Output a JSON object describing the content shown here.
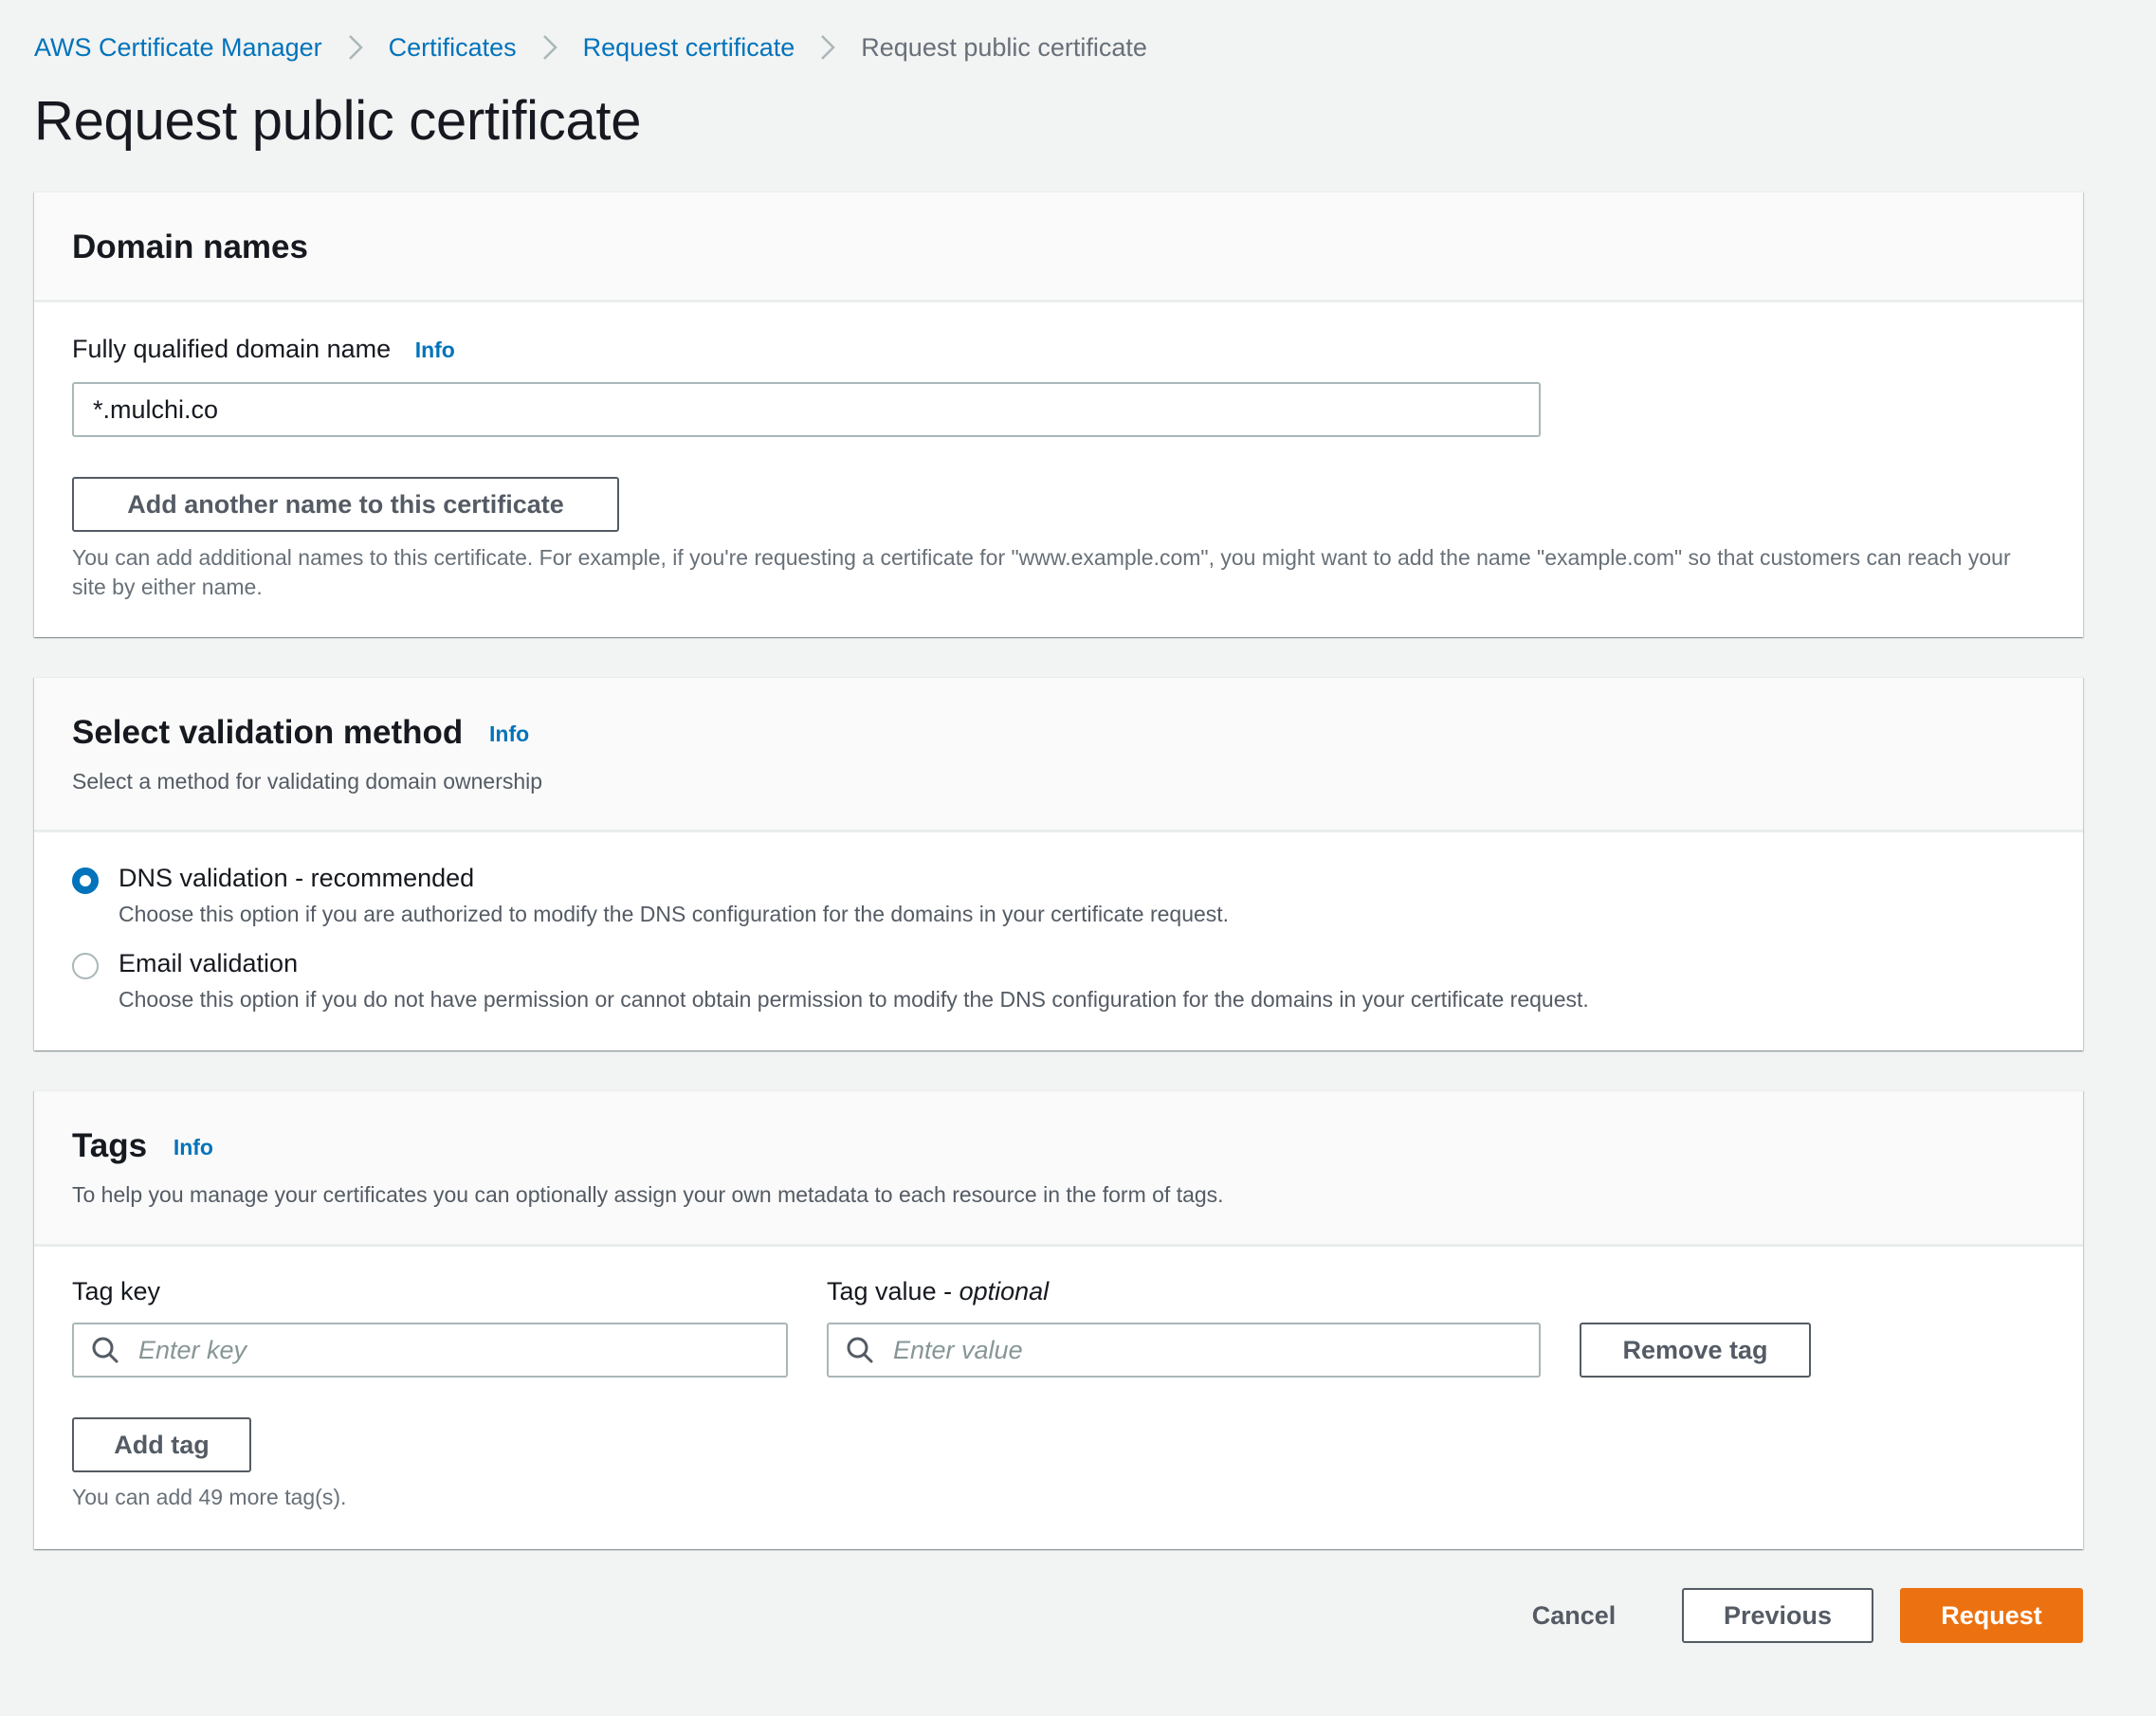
{
  "breadcrumb": {
    "items": [
      {
        "label": "AWS Certificate Manager",
        "link": true
      },
      {
        "label": "Certificates",
        "link": true
      },
      {
        "label": "Request certificate",
        "link": true
      },
      {
        "label": "Request public certificate",
        "link": false
      }
    ]
  },
  "page": {
    "title": "Request public certificate"
  },
  "domain_names": {
    "title": "Domain names",
    "fqdn_label": "Fully qualified domain name",
    "info_label": "Info",
    "fqdn_value": "*.mulchi.co",
    "add_name_button": "Add another name to this certificate",
    "help_text": "You can add additional names to this certificate. For example, if you're requesting a certificate for \"www.example.com\", you might want to add the name \"example.com\" so that customers can reach your site by either name."
  },
  "validation": {
    "title": "Select validation method",
    "info_label": "Info",
    "description": "Select a method for validating domain ownership",
    "options": [
      {
        "label": "DNS validation - recommended",
        "description": "Choose this option if you are authorized to modify the DNS configuration for the domains in your certificate request.",
        "checked": true
      },
      {
        "label": "Email validation",
        "description": "Choose this option if you do not have permission or cannot obtain permission to modify the DNS configuration for the domains in your certificate request.",
        "checked": false
      }
    ]
  },
  "tags": {
    "title": "Tags",
    "info_label": "Info",
    "description": "To help you manage your certificates you can optionally assign your own metadata to each resource in the form of tags.",
    "key_label": "Tag key",
    "value_label": "Tag value - ",
    "value_label_optional": "optional",
    "key_placeholder": "Enter key",
    "value_placeholder": "Enter value",
    "key_value": "",
    "value_value": "",
    "remove_button": "Remove tag",
    "add_button": "Add tag",
    "remaining_text": "You can add 49 more tag(s)."
  },
  "footer": {
    "cancel_label": "Cancel",
    "previous_label": "Previous",
    "request_label": "Request"
  },
  "colors": {
    "accent_link": "#0073bb",
    "primary_button": "#ec7211",
    "background": "#f2f3f3"
  }
}
